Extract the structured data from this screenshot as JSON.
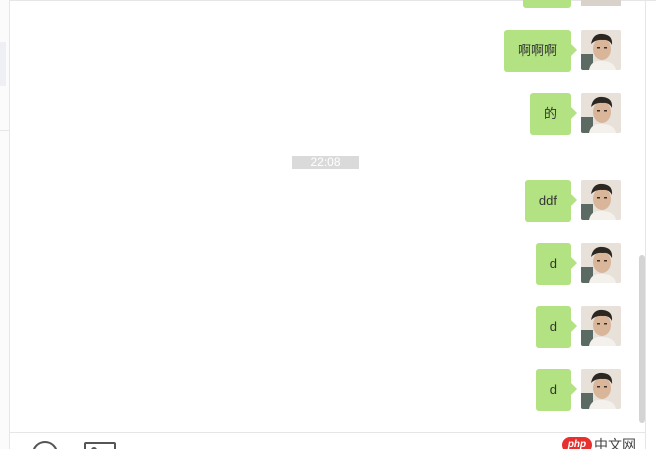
{
  "chat": {
    "time_divider": "22:08",
    "messages_before": [
      {
        "text": "啊啊啊",
        "sender": "me"
      },
      {
        "text": "的",
        "sender": "me"
      }
    ],
    "messages_after": [
      {
        "text": "ddf",
        "sender": "me"
      },
      {
        "text": "d",
        "sender": "me"
      },
      {
        "text": "d",
        "sender": "me"
      },
      {
        "text": "d",
        "sender": "me"
      }
    ]
  },
  "toolbar": {
    "emoji_icon": "smiley-icon",
    "image_icon": "image-icon"
  },
  "watermark": {
    "logo_text": "php",
    "site_text": "中文网"
  },
  "colors": {
    "bubble": "#b2e281",
    "time_badge": "#dadada",
    "brand_red": "#e8312f"
  }
}
